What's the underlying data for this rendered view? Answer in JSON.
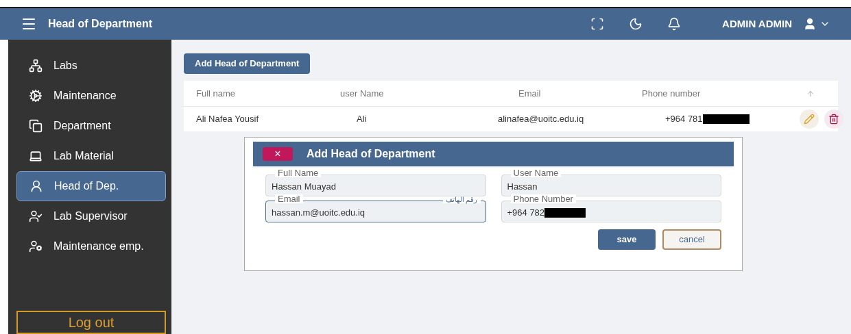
{
  "header": {
    "title": "Head of Department",
    "user": "ADMIN ADMIN"
  },
  "sidebar": {
    "items": [
      {
        "label": "Labs",
        "selected": false
      },
      {
        "label": "Maintenance",
        "selected": false
      },
      {
        "label": "Department",
        "selected": false
      },
      {
        "label": "Lab Material",
        "selected": false
      },
      {
        "label": "Head of Dep.",
        "selected": true
      },
      {
        "label": "Lab Supervisor",
        "selected": false
      },
      {
        "label": "Maintenance emp.",
        "selected": false
      }
    ],
    "logout": "Log out"
  },
  "add_button": "Add Head of Department",
  "table": {
    "columns": [
      "Full name",
      "user Name",
      "Email",
      "Phone number"
    ],
    "rows": [
      {
        "full_name": "Ali Nafea Yousif",
        "user_name": "Ali",
        "email": "alinafea@uoitc.edu.iq",
        "phone": "+964 781",
        "phone_redacted": true
      }
    ]
  },
  "dialog": {
    "title": "Add Head of Department",
    "close": "×",
    "fields": [
      {
        "label": "Full Name",
        "value": "Hassan Muayad",
        "focused": false,
        "redacted": false
      },
      {
        "label": "User Name",
        "value": "Hassan",
        "focused": false,
        "redacted": false
      },
      {
        "label": "Email",
        "value": "hassan.m@uoitc.edu.iq",
        "focused": true,
        "hint": "رقم الهاتف",
        "redacted": false
      },
      {
        "label": "Phone Number",
        "value": "+964 782",
        "focused": false,
        "redacted": true
      }
    ],
    "buttons": [
      {
        "label": "save",
        "kind": "primary"
      },
      {
        "label": "cancel",
        "kind": "outline"
      }
    ]
  }
}
